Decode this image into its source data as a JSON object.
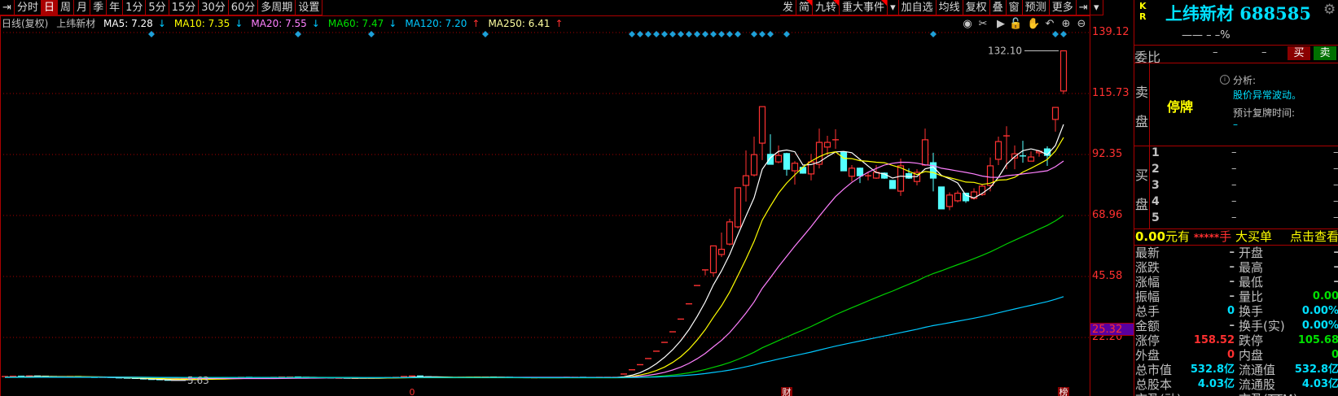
{
  "toolbar_left": [
    {
      "label": "分时"
    },
    {
      "label": "日",
      "active": true
    },
    {
      "label": "周"
    },
    {
      "label": "月"
    },
    {
      "label": "季"
    },
    {
      "label": "年"
    },
    {
      "label": "1分"
    },
    {
      "label": "5分"
    },
    {
      "label": "15分"
    },
    {
      "label": "30分"
    },
    {
      "label": "60分"
    },
    {
      "label": "多周期"
    },
    {
      "label": "设置"
    }
  ],
  "toolbar_right": [
    {
      "label": "发"
    },
    {
      "label": "简",
      "corner": true
    },
    {
      "label": "九转",
      "corner": true
    },
    {
      "label": "重大事件",
      "corner": true
    },
    {
      "label": "▾"
    },
    {
      "label": "加自选"
    },
    {
      "label": "均线"
    },
    {
      "label": "复权"
    },
    {
      "label": "叠"
    },
    {
      "label": "窗"
    },
    {
      "label": "预测"
    },
    {
      "label": "更多"
    }
  ],
  "info": {
    "period": "日线(复权)",
    "name": "上纬新材",
    "ma": [
      {
        "text": "MA5: 7.28",
        "arrow": "↓",
        "color": "#ffffff",
        "arrow_color": "#00c8ff"
      },
      {
        "text": "MA10: 7.35",
        "arrow": "↓",
        "color": "#ffff00",
        "arrow_color": "#00c8ff"
      },
      {
        "text": "MA20: 7.55",
        "arrow": "↓",
        "color": "#ff80ff",
        "arrow_color": "#00c8ff"
      },
      {
        "text": "MA60: 7.47",
        "arrow": "↓",
        "color": "#00e000",
        "arrow_color": "#00c8ff"
      },
      {
        "text": "MA120: 7.20",
        "arrow": "↑",
        "color": "#00c8ff",
        "arrow_color": "#ff3030"
      },
      {
        "text": "MA250: 6.41",
        "arrow": "↑",
        "color": "#ffffa0",
        "arrow_color": "#ff3030"
      }
    ]
  },
  "tool_icons": [
    "eye-icon",
    "scissors-icon",
    "play-icon",
    "lock-icon",
    "hand-icon",
    "undo-icon",
    "zoom-in-icon",
    "zoom-out-icon"
  ],
  "chart_data": {
    "type": "candlestick",
    "y_ticks": [
      "139.12",
      "115.73",
      "92.35",
      "68.96",
      "45.58",
      "22.20"
    ],
    "y_tick_values": [
      139.12,
      115.73,
      92.35,
      68.96,
      45.58,
      22.2
    ],
    "current_price_label": "25.32",
    "high_label": "132.10",
    "low_label": "5.63",
    "prior_bars": {
      "count": 120,
      "close": 6.9
    },
    "flat_closes": [
      7.2,
      7.3,
      7.1,
      7.4,
      7.3,
      7.2,
      7.0,
      7.1,
      7.2,
      7.0,
      6.9,
      6.8,
      6.9,
      6.7,
      6.6,
      6.5,
      6.3,
      6.1,
      6.0,
      5.8,
      5.63,
      5.9,
      6.2,
      6.4,
      6.5,
      6.6,
      6.7,
      6.8,
      6.8,
      6.9,
      6.8,
      6.7,
      6.8,
      6.9,
      7.0,
      7.0,
      6.9,
      6.8,
      6.8,
      6.7,
      6.6,
      6.6,
      6.5,
      6.5,
      6.6,
      6.6,
      6.7,
      6.8,
      6.9,
      7.2,
      7.4,
      7.1,
      7.0,
      6.9,
      6.8,
      6.8,
      6.9,
      6.9,
      7.0,
      7.0,
      6.9,
      6.9,
      6.8,
      6.8,
      6.7,
      6.7,
      6.8,
      6.8,
      6.8,
      6.9,
      6.9,
      6.8,
      6.8,
      6.9,
      6.9,
      6.9
    ],
    "limit_up_closes": [
      8.16,
      9.79,
      11.75,
      14.1,
      16.92,
      20.3,
      24.36,
      29.23,
      35.08,
      42.1
    ],
    "ohlc": [
      [
        48.1,
        48.1,
        46,
        48.1
      ],
      [
        47,
        57.3,
        45.5,
        57.3
      ],
      [
        54,
        62.4,
        53,
        56
      ],
      [
        58,
        67.7,
        57.5,
        66.5
      ],
      [
        64.6,
        79.6,
        64,
        79.6
      ],
      [
        80.5,
        93.9,
        74.3,
        84.2
      ],
      [
        84.5,
        99.2,
        83.9,
        92.3
      ],
      [
        96.7,
        110.7,
        90.2,
        110.7
      ],
      [
        92.4,
        100.1,
        88.6,
        88.6
      ],
      [
        89.5,
        95.8,
        89,
        92
      ],
      [
        92.7,
        93,
        84.2,
        86.7
      ],
      [
        86.1,
        89.8,
        80.8,
        89
      ],
      [
        87.4,
        87.8,
        85,
        85.2
      ],
      [
        84.9,
        92.6,
        82.4,
        89.5
      ],
      [
        88.6,
        102.3,
        87,
        97
      ],
      [
        95.2,
        99.5,
        92,
        97
      ],
      [
        98,
        102,
        94.5,
        98
      ],
      [
        93.3,
        93.5,
        86,
        86.1
      ],
      [
        84,
        88.3,
        82,
        87.1
      ],
      [
        87.1,
        87.3,
        81.4,
        84.2
      ],
      [
        84.2,
        85.5,
        82.4,
        84.2
      ],
      [
        83.3,
        88.3,
        83,
        85.5
      ],
      [
        85.2,
        85.5,
        83,
        83.3
      ],
      [
        82.4,
        82.4,
        79.3,
        79.3
      ],
      [
        78.3,
        90.8,
        76.5,
        88
      ],
      [
        85,
        87,
        83,
        83.3
      ],
      [
        82,
        86.7,
        80.5,
        85.5
      ],
      [
        88.3,
        102.3,
        88,
        98
      ],
      [
        89.2,
        93,
        78.2,
        83.3
      ],
      [
        79.9,
        79.9,
        71.5,
        71.5
      ],
      [
        72.4,
        77.8,
        71,
        76.8
      ],
      [
        74.6,
        78.5,
        74,
        77.5
      ],
      [
        77.5,
        77.6,
        73.8,
        74.6
      ],
      [
        75.5,
        79.4,
        75,
        78
      ],
      [
        77,
        81,
        76.5,
        80.2
      ],
      [
        80.5,
        91.2,
        78.2,
        88
      ],
      [
        90.5,
        99.2,
        88.3,
        97.3
      ],
      [
        99.3,
        103.2,
        86.7,
        99.5
      ],
      [
        91,
        95.8,
        86.7,
        92.6
      ],
      [
        91.8,
        97.6,
        89.2,
        91.7
      ],
      [
        89.8,
        93.5,
        89.8,
        91.4
      ],
      [
        93,
        94,
        91.5,
        93.6
      ],
      [
        94.5,
        95.5,
        88,
        92
      ],
      [
        105.8,
        110.4,
        101.1,
        110.4
      ],
      [
        116.7,
        132.1,
        115.5,
        132.1
      ]
    ],
    "ma_periods": [
      5,
      10,
      20,
      60,
      120,
      250
    ],
    "ma_colors": [
      "#ffffff",
      "#ffff00",
      "#ff80ff",
      "#00d000",
      "#00c8ff",
      "#ffffa0"
    ],
    "marker_bars": [
      18,
      36,
      45,
      59,
      77,
      78,
      79,
      80,
      81,
      82,
      83,
      84,
      85,
      86,
      87,
      88,
      89,
      90,
      92,
      93,
      94,
      96,
      114,
      129,
      130
    ],
    "event_labels": [
      {
        "bar": 50,
        "text": "0",
        "kind": "plain"
      },
      {
        "bar": 96,
        "text": "财",
        "kind": "box"
      },
      {
        "bar": 130,
        "text": "榜",
        "kind": "box"
      }
    ],
    "up_color": "#ff3232",
    "down_color": "#54ffff"
  },
  "panel": {
    "kr": [
      "K",
      "R"
    ],
    "title": "上纬新材 688585",
    "price_line": "——  –  –%",
    "weibi_label": "委比",
    "weibi_values": [
      "–",
      "–"
    ],
    "buy_btn": "买",
    "sell_btn": "卖",
    "sell_label": [
      "卖",
      "盘"
    ],
    "buy_label": [
      "买",
      "盘"
    ],
    "halt": "停牌",
    "analysis_label": "分析:",
    "analysis_text": "股价异常波动。",
    "resume_label": "预计复牌时间:",
    "resume_value": "–",
    "bids": [
      {
        "n": "1",
        "a": "–",
        "b": "–"
      },
      {
        "n": "2",
        "a": "–",
        "b": "–"
      },
      {
        "n": "3",
        "a": "–",
        "b": "–"
      },
      {
        "n": "4",
        "a": "–",
        "b": "–"
      },
      {
        "n": "5",
        "a": "–",
        "b": "–"
      }
    ],
    "bigorder": {
      "amount": "0.00",
      "unit": "元有",
      "stars": "*****",
      "hand": "手",
      "label": "大买单",
      "link": "点击查看"
    },
    "stats": [
      {
        "l1": "最新",
        "v1": "–",
        "c1": "#c0c0c0",
        "l2": "开盘",
        "v2": "–",
        "c2": "#c0c0c0"
      },
      {
        "l1": "涨跌",
        "v1": "–",
        "c1": "#c0c0c0",
        "l2": "最高",
        "v2": "–",
        "c2": "#c0c0c0"
      },
      {
        "l1": "涨幅",
        "v1": "–",
        "c1": "#c0c0c0",
        "l2": "最低",
        "v2": "–",
        "c2": "#c0c0c0"
      },
      {
        "l1": "振幅",
        "v1": "–",
        "c1": "#c0c0c0",
        "l2": "量比",
        "v2": "0.00",
        "c2": "#00e000"
      },
      {
        "l1": "总手",
        "v1": "0",
        "c1": "#00e0ff",
        "l2": "换手",
        "v2": "0.00%",
        "c2": "#00e0ff"
      },
      {
        "l1": "金额",
        "v1": "–",
        "c1": "#c0c0c0",
        "l2": "换手(实)",
        "v2": "0.00%",
        "c2": "#00e0ff"
      },
      {
        "l1": "涨停",
        "v1": "158.52",
        "c1": "#ff3030",
        "l2": "跌停",
        "v2": "105.68",
        "c2": "#00e000"
      },
      {
        "l1": "外盘",
        "v1": "0",
        "c1": "#ff3030",
        "l2": "内盘",
        "v2": "0",
        "c2": "#00e000"
      },
      {
        "l1": "总市值",
        "v1": "532.8亿",
        "c1": "#00e0ff",
        "l2": "流通值",
        "v2": "532.8亿",
        "c2": "#00e0ff"
      },
      {
        "l1": "总股本",
        "v1": "4.03亿",
        "c1": "#00e0ff",
        "l2": "流通股",
        "v2": "4.03亿",
        "c2": "#00e0ff"
      },
      {
        "l1": "市盈(动)",
        "v1": "",
        "c1": "#c0c0c0",
        "l2": "市盈(TTM)",
        "v2": "",
        "c2": "#c0c0c0"
      }
    ]
  }
}
